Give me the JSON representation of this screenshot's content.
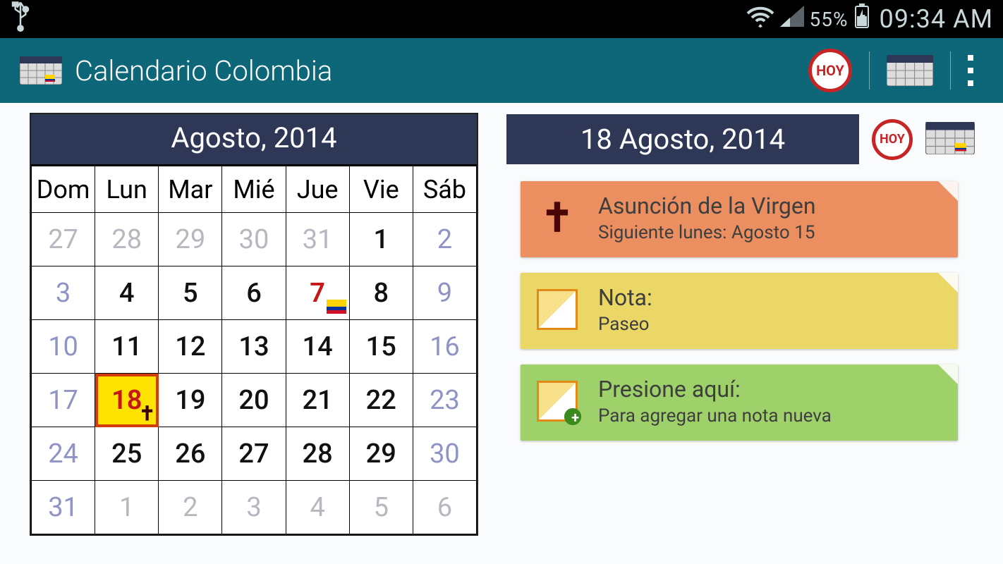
{
  "status": {
    "battery_percent": "55%",
    "time": "09:34 AM"
  },
  "appbar": {
    "title": "Calendario Colombia",
    "hoy_label": "HOY"
  },
  "calendar": {
    "title": "Agosto, 2014",
    "weekdays": [
      "Dom",
      "Lun",
      "Mar",
      "Mié",
      "Jue",
      "Vie",
      "Sáb"
    ],
    "weeks": [
      [
        {
          "n": "27",
          "cls": "muted"
        },
        {
          "n": "28",
          "cls": "muted"
        },
        {
          "n": "29",
          "cls": "muted"
        },
        {
          "n": "30",
          "cls": "muted"
        },
        {
          "n": "31",
          "cls": "muted"
        },
        {
          "n": "1",
          "cls": "normal"
        },
        {
          "n": "2",
          "cls": "wknd"
        }
      ],
      [
        {
          "n": "3",
          "cls": "wknd"
        },
        {
          "n": "4",
          "cls": "normal"
        },
        {
          "n": "5",
          "cls": "normal"
        },
        {
          "n": "6",
          "cls": "normal"
        },
        {
          "n": "7",
          "cls": "holiday",
          "deco": "flag"
        },
        {
          "n": "8",
          "cls": "normal"
        },
        {
          "n": "9",
          "cls": "wknd"
        }
      ],
      [
        {
          "n": "10",
          "cls": "wknd"
        },
        {
          "n": "11",
          "cls": "normal"
        },
        {
          "n": "12",
          "cls": "normal"
        },
        {
          "n": "13",
          "cls": "normal"
        },
        {
          "n": "14",
          "cls": "normal"
        },
        {
          "n": "15",
          "cls": "normal"
        },
        {
          "n": "16",
          "cls": "wknd"
        }
      ],
      [
        {
          "n": "17",
          "cls": "wknd"
        },
        {
          "n": "18",
          "cls": "holiday",
          "today": true,
          "deco": "cross"
        },
        {
          "n": "19",
          "cls": "normal"
        },
        {
          "n": "20",
          "cls": "normal"
        },
        {
          "n": "21",
          "cls": "normal"
        },
        {
          "n": "22",
          "cls": "normal"
        },
        {
          "n": "23",
          "cls": "wknd"
        }
      ],
      [
        {
          "n": "24",
          "cls": "wknd"
        },
        {
          "n": "25",
          "cls": "normal"
        },
        {
          "n": "26",
          "cls": "normal"
        },
        {
          "n": "27",
          "cls": "normal"
        },
        {
          "n": "28",
          "cls": "normal"
        },
        {
          "n": "29",
          "cls": "normal"
        },
        {
          "n": "30",
          "cls": "wknd"
        }
      ],
      [
        {
          "n": "31",
          "cls": "wknd"
        },
        {
          "n": "1",
          "cls": "muted"
        },
        {
          "n": "2",
          "cls": "muted"
        },
        {
          "n": "3",
          "cls": "muted"
        },
        {
          "n": "4",
          "cls": "muted"
        },
        {
          "n": "5",
          "cls": "muted"
        },
        {
          "n": "6",
          "cls": "muted"
        }
      ]
    ]
  },
  "detail": {
    "date_label": "18 Agosto, 2014",
    "hoy_label": "HOY",
    "cards": {
      "holiday": {
        "title": "Asunción de la Virgen",
        "subtitle": "Siguiente lunes: Agosto 15"
      },
      "note": {
        "title": "Nota:",
        "subtitle": "Paseo"
      },
      "add": {
        "title": "Presione aquí:",
        "subtitle": "Para agregar una nota nueva"
      }
    }
  }
}
